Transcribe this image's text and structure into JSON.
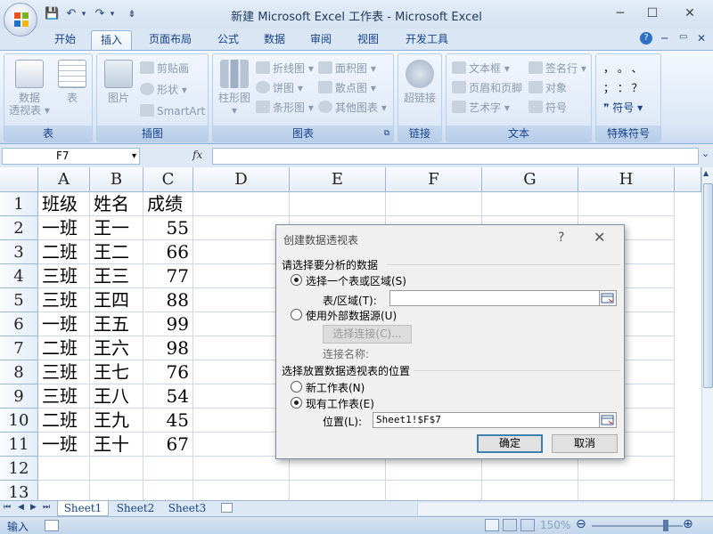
{
  "window": {
    "title": "新建 Microsoft Excel 工作表 - Microsoft Excel",
    "minimize_glyph": "─",
    "maximize_glyph": "☐",
    "close_glyph": "✕"
  },
  "qat": {
    "save_glyph": "💾",
    "undo_glyph": "↶",
    "undo_dropdown_glyph": "▾",
    "redo_glyph": "↷",
    "redo_dropdown_glyph": "▾",
    "customize_glyph": "⇟"
  },
  "tabs": [
    {
      "label": "开始"
    },
    {
      "label": "插入",
      "active": true
    },
    {
      "label": "页面布局"
    },
    {
      "label": "公式"
    },
    {
      "label": "数据"
    },
    {
      "label": "审阅"
    },
    {
      "label": "视图"
    },
    {
      "label": "开发工具"
    }
  ],
  "tab_icons": {
    "help": "?",
    "min": "─",
    "restore": "▭",
    "close": "✕"
  },
  "ribbon": {
    "groups": {
      "table": "表",
      "illustrations": "插图",
      "charts": "图表",
      "links": "链接",
      "text": "文本",
      "symbols": "特殊符号"
    },
    "pivot_line1": "数据",
    "pivot_line2": "透视表 ▾",
    "table_btn": "表",
    "picture_btn": "图片",
    "clipart": "剪贴画",
    "shapes": "形状 ▾",
    "smartart": "SmartArt",
    "column_chart": "柱形图",
    "column_chart_arrow": "▾",
    "line_chart": "折线图 ▾",
    "pie_chart": "饼图 ▾",
    "bar_chart": "条形图 ▾",
    "area_chart": "面积图 ▾",
    "scatter_chart": "散点图 ▾",
    "other_chart": "其他图表 ▾",
    "hyperlink": "超链接",
    "textbox": "文本框 ▾",
    "header_footer": "页眉和页脚",
    "wordart": "艺术字 ▾",
    "signature": "签名行 ▾",
    "object": "对象",
    "symbol": "符号",
    "sym_row1": "，  。  、",
    "sym_row2": "；  ：  ？",
    "sym_btn": "❞ 符号 ▾",
    "dialog_launcher": "⧉"
  },
  "formula_bar": {
    "name_box": "F7",
    "name_dropdown": "▾",
    "fx": "fx",
    "value": "",
    "expand_glyph": "⌄"
  },
  "columns": [
    "A",
    "B",
    "C",
    "D",
    "E",
    "F",
    "G",
    "H"
  ],
  "rows": [
    "1",
    "2",
    "3",
    "4",
    "5",
    "6",
    "7",
    "8",
    "9",
    "10",
    "11",
    "12",
    "13"
  ],
  "cells": [
    [
      "班级",
      "姓名",
      "成绩"
    ],
    [
      "一班",
      "王一",
      "55"
    ],
    [
      "二班",
      "王二",
      "66"
    ],
    [
      "三班",
      "王三",
      "77"
    ],
    [
      "三班",
      "王四",
      "88"
    ],
    [
      "一班",
      "王五",
      "99"
    ],
    [
      "二班",
      "王六",
      "98"
    ],
    [
      "三班",
      "王七",
      "76"
    ],
    [
      "三班",
      "王八",
      "54"
    ],
    [
      "二班",
      "王九",
      "45"
    ],
    [
      "一班",
      "王十",
      "67"
    ]
  ],
  "sheet_tabs": [
    {
      "label": "Sheet1",
      "active": true
    },
    {
      "label": "Sheet2"
    },
    {
      "label": "Sheet3"
    }
  ],
  "sheet_nav": {
    "first": "⏮",
    "prev": "◀",
    "next": "▶",
    "last": "⏭"
  },
  "status": {
    "mode": "输入",
    "zoom": "150%",
    "zoom_out": "⊖",
    "zoom_in": "⊕"
  },
  "dialog": {
    "title": "创建数据透视表",
    "help": "?",
    "close": "✕",
    "section1": "请选择要分析的数据",
    "opt_range": "选择一个表或区域(S)",
    "range_label": "表/区域(T):",
    "range_value": "",
    "opt_external": "使用外部数据源(U)",
    "choose_conn": "选择连接(C)...",
    "conn_name_label": "连接名称:",
    "section2": "选择放置数据透视表的位置",
    "opt_new_sheet": "新工作表(N)",
    "opt_existing": "现有工作表(E)",
    "location_label": "位置(L):",
    "location_value": "Sheet1!$F$7",
    "ok": "确定",
    "cancel": "取消"
  }
}
